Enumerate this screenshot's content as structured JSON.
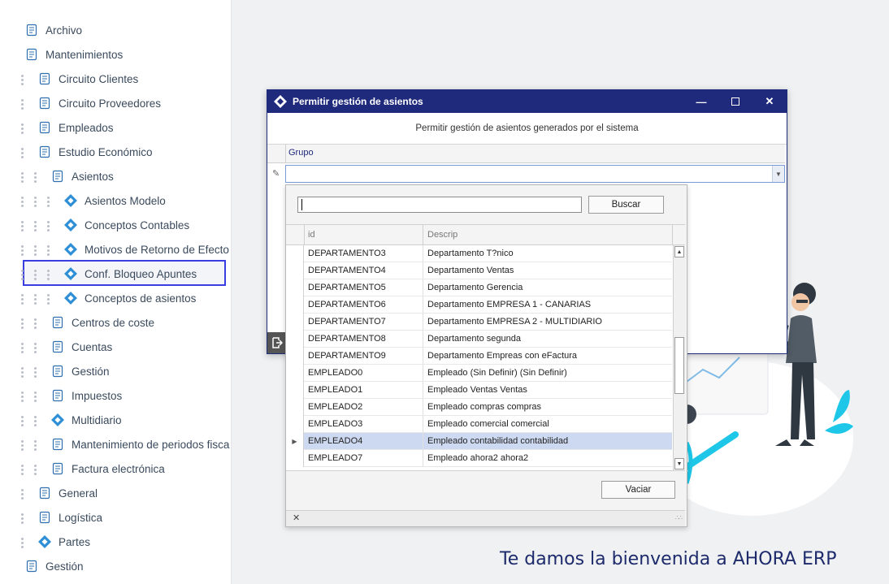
{
  "sidebar": {
    "items": [
      {
        "label": "Archivo",
        "icon": "document-icon"
      },
      {
        "label": "Mantenimientos",
        "icon": "tools-icon"
      },
      {
        "label": "Circuito Clientes",
        "icon": "client-circle-icon"
      },
      {
        "label": "Circuito Proveedores",
        "icon": "supplier-flow-icon"
      },
      {
        "label": "Empleados",
        "icon": "people-icon"
      },
      {
        "label": "Estudio Económico",
        "icon": "chart-icon"
      },
      {
        "label": "Asientos",
        "icon": "folder-icon"
      },
      {
        "label": "Asientos Modelo",
        "icon": "ahora-logo-icon"
      },
      {
        "label": "Conceptos Contables",
        "icon": "ahora-logo-icon"
      },
      {
        "label": "Motivos de Retorno de Efecto",
        "icon": "ahora-logo-icon"
      },
      {
        "label": "Conf. Bloqueo Apuntes",
        "icon": "ahora-logo-icon"
      },
      {
        "label": "Conceptos de asientos",
        "icon": "ahora-logo-icon"
      },
      {
        "label": "Centros de coste",
        "icon": "calculator-icon"
      },
      {
        "label": "Cuentas",
        "icon": "accounts-icon"
      },
      {
        "label": "Gestión",
        "icon": "clipboard-icon"
      },
      {
        "label": "Impuestos",
        "icon": "tax-icon"
      },
      {
        "label": "Multidiario",
        "icon": "ahora-logo-icon"
      },
      {
        "label": "Mantenimiento de periodos fisca",
        "icon": "ledger-icon"
      },
      {
        "label": "Factura electrónica",
        "icon": "einvoice-icon"
      },
      {
        "label": "General",
        "icon": "globe-icon"
      },
      {
        "label": "Logística",
        "icon": "logistics-icon"
      },
      {
        "label": "Partes",
        "icon": "ahora-logo-icon"
      },
      {
        "label": "Gestión",
        "icon": "clipboard-icon"
      }
    ]
  },
  "dialog": {
    "title": "Permitir gestión de asientos",
    "subtitle": "Permitir gestión de asientos generados por el sistema",
    "column_header": "Grupo",
    "combo_value": ""
  },
  "popup": {
    "search_value": "",
    "search_button": "Buscar",
    "clear_button": "Vaciar",
    "close_glyph": "✕",
    "columns": [
      "id",
      "Descrip"
    ],
    "rows": [
      {
        "id": "DEPARTAMENTO3",
        "descrip": "Departamento T?nico"
      },
      {
        "id": "DEPARTAMENTO4",
        "descrip": "Departamento Ventas"
      },
      {
        "id": "DEPARTAMENTO5",
        "descrip": "Departamento Gerencia"
      },
      {
        "id": "DEPARTAMENTO6",
        "descrip": "Departamento EMPRESA 1 - CANARIAS"
      },
      {
        "id": "DEPARTAMENTO7",
        "descrip": "Departamento EMPRESA 2 - MULTIDIARIO"
      },
      {
        "id": "DEPARTAMENTO8",
        "descrip": "Departamento segunda"
      },
      {
        "id": "DEPARTAMENTO9",
        "descrip": "Departamento Empreas con eFactura"
      },
      {
        "id": "EMPLEADO0",
        "descrip": "Empleado (Sin Definir) (Sin Definir)"
      },
      {
        "id": "EMPLEADO1",
        "descrip": "Empleado Ventas Ventas"
      },
      {
        "id": "EMPLEADO2",
        "descrip": "Empleado compras compras"
      },
      {
        "id": "EMPLEADO3",
        "descrip": "Empleado comercial comercial"
      },
      {
        "id": "EMPLEADO4",
        "descrip": "Empleado contabilidad contabilidad",
        "selected": true
      },
      {
        "id": "EMPLEADO7",
        "descrip": "Empleado ahora2 ahora2"
      }
    ]
  },
  "welcome": {
    "title": "Te damos la bienvenida a AHORA ERP"
  },
  "colors": {
    "brand_navy": "#1f2a7c",
    "ahora_blue": "#2e8fd6",
    "highlight_border": "#3b3ee0",
    "selected_row": "#cdd9f0",
    "illustration_cyan": "#1ec7e8"
  }
}
